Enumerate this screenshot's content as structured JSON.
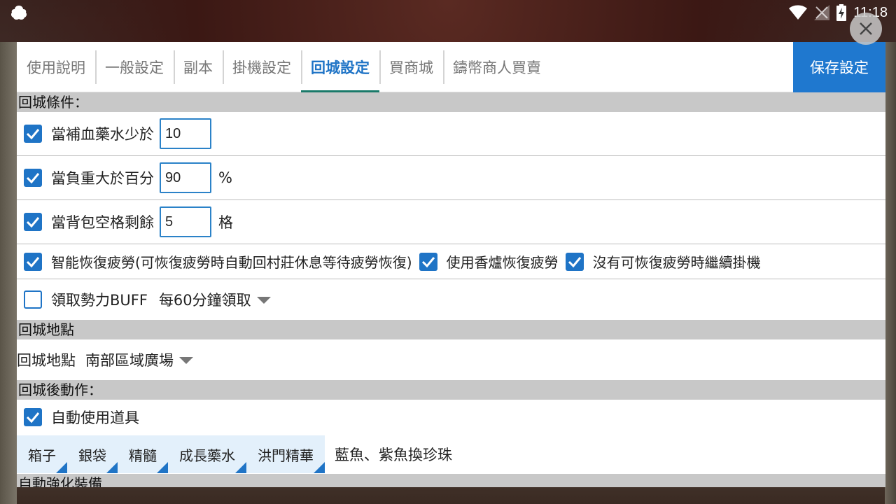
{
  "status": {
    "time": "11:18"
  },
  "tabs": [
    {
      "label": "使用說明",
      "active": false
    },
    {
      "label": "一般設定",
      "active": false
    },
    {
      "label": "副本",
      "active": false
    },
    {
      "label": "掛機設定",
      "active": false
    },
    {
      "label": "回城設定",
      "active": true
    },
    {
      "label": "買商城",
      "active": false
    },
    {
      "label": "鑄幣商人買賣",
      "active": false
    }
  ],
  "save_label": "保存設定",
  "conditions": {
    "header": "回城條件：",
    "potion": {
      "label": "當補血藥水少於",
      "value": "10",
      "checked": true
    },
    "weight": {
      "label": "當負重大於百分",
      "value": "90",
      "unit": "%",
      "checked": true
    },
    "bag": {
      "label": "當背包空格剩餘",
      "value": "5",
      "unit": "格",
      "checked": true
    },
    "fatigue": {
      "label": "智能恢復疲勞(可恢復疲勞時自動回村莊休息等待疲勞恢復)",
      "checked": true
    },
    "incense": {
      "label": "使用香爐恢復疲勞",
      "checked": true
    },
    "continue": {
      "label": "沒有可恢復疲勞時繼續掛機",
      "checked": true
    },
    "buff": {
      "label": "領取勢力BUFF",
      "checked": false,
      "interval": "每60分鐘領取"
    }
  },
  "location": {
    "header": "回城地點",
    "label": "回城地點",
    "value": "南部區域廣場"
  },
  "after": {
    "header": "回城後動作：",
    "auto_use": {
      "label": "自動使用道具",
      "checked": true
    },
    "items": [
      "箱子",
      "銀袋",
      "精髓",
      "成長藥水",
      "洪門精華"
    ],
    "exchange": "藍魚、紫魚換珍珠",
    "next_header": "自動強化裝備"
  },
  "colors": {
    "accent": "#1f74c6",
    "save_bg": "#1f78cf",
    "section_bg": "#c8c8c8"
  }
}
